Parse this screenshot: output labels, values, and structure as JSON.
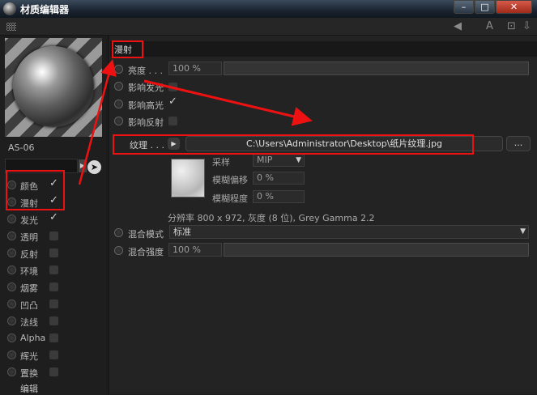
{
  "window": {
    "title": "材质编辑器",
    "min": "–",
    "max": "□",
    "close": "✕"
  },
  "toolbar": {
    "icons": [
      "arrow-back-icon",
      "text-icon",
      "lock-icon",
      "save-icon"
    ]
  },
  "material": {
    "name": "AS-06"
  },
  "channels": [
    {
      "label": "颜色",
      "state": "checked"
    },
    {
      "label": "漫射",
      "state": "checked"
    },
    {
      "label": "发光",
      "state": "checked"
    },
    {
      "label": "透明",
      "state": "unchecked"
    },
    {
      "label": "反射",
      "state": "unchecked"
    },
    {
      "label": "环境",
      "state": "unchecked"
    },
    {
      "label": "烟雾",
      "state": "unchecked"
    },
    {
      "label": "凹凸",
      "state": "unchecked"
    },
    {
      "label": "法线",
      "state": "unchecked"
    },
    {
      "label": "Alpha",
      "state": "unchecked"
    },
    {
      "label": "辉光",
      "state": "unchecked"
    },
    {
      "label": "置换",
      "state": "unchecked"
    }
  ],
  "edit_label": "编辑",
  "section": {
    "title": "漫射"
  },
  "brightness": {
    "label": "亮度 . . .",
    "value": "100 %"
  },
  "options": [
    {
      "label": "影响发光",
      "checked": false
    },
    {
      "label": "影响高光",
      "checked": true
    },
    {
      "label": "影响反射",
      "checked": false
    }
  ],
  "texture": {
    "label": "纹理 . . .",
    "path": "C:\\Users\\Administrator\\Desktop\\纸片纹理.jpg",
    "more": "...",
    "sampling_label": "采样",
    "sampling_value": "MIP",
    "blur_offset_label": "模糊偏移",
    "blur_offset_value": "0 %",
    "blur_degree_label": "模糊程度",
    "blur_degree_value": "0 %",
    "info": "分辨率 800 x 972, 灰度 (8 位), Grey Gamma 2.2"
  },
  "blend_mode": {
    "label": "混合模式",
    "value": "标准"
  },
  "blend_strength": {
    "label": "混合强度",
    "value": "100 %"
  },
  "annotation_color": "#ee1111"
}
